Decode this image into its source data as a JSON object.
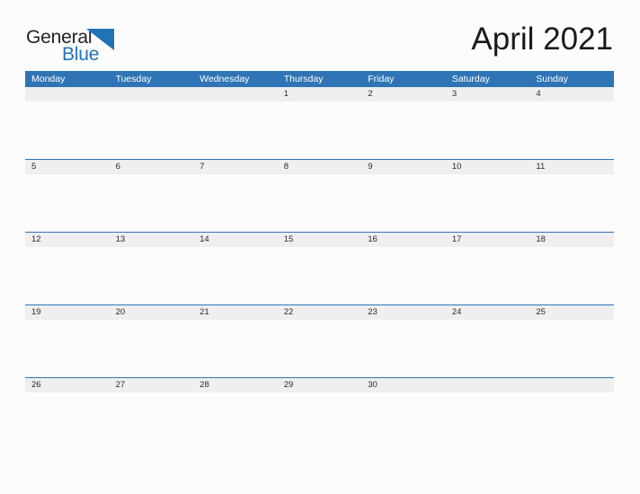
{
  "brand": {
    "name_part1": "General",
    "name_part2": "Blue",
    "flag_icon": "blue-flag-triangle",
    "primary_color": "#2272b8"
  },
  "header": {
    "title": "April 2021",
    "month": "April",
    "year": "2021"
  },
  "theme": {
    "header_blue": "#2f75b5",
    "band_gray": "#efefef",
    "separator_blue": "#2f75b5",
    "page_background": "#fcfcfd",
    "text_color": "#2b2b2b"
  },
  "calendar": {
    "weekdays": [
      "Monday",
      "Tuesday",
      "Wednesday",
      "Thursday",
      "Friday",
      "Saturday",
      "Sunday"
    ],
    "weeks": [
      [
        "",
        "",
        "",
        "1",
        "2",
        "3",
        "4"
      ],
      [
        "5",
        "6",
        "7",
        "8",
        "9",
        "10",
        "11"
      ],
      [
        "12",
        "13",
        "14",
        "15",
        "16",
        "17",
        "18"
      ],
      [
        "19",
        "20",
        "21",
        "22",
        "23",
        "24",
        "25"
      ],
      [
        "26",
        "27",
        "28",
        "29",
        "30",
        "",
        ""
      ]
    ]
  }
}
